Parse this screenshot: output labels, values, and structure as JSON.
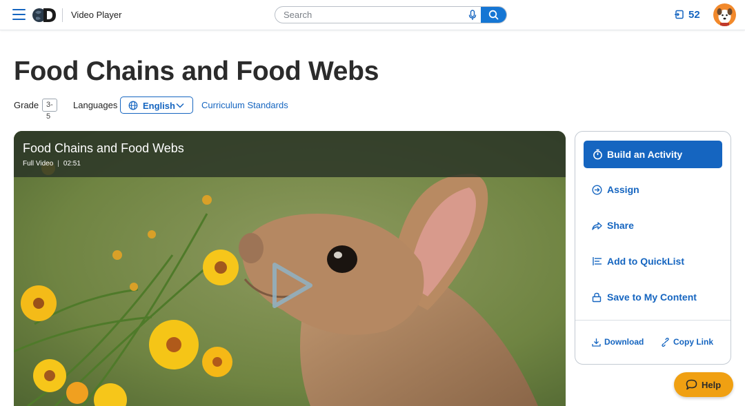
{
  "header": {
    "app_title": "Video Player",
    "search_placeholder": "Search",
    "notification_count": "52",
    "icons": [
      "menu-icon",
      "discovery-logo",
      "microphone-icon",
      "search-icon",
      "notification-icon",
      "avatar"
    ]
  },
  "page": {
    "title": "Food Chains and Food Webs",
    "grade_label": "Grade",
    "grade_value": "3-5",
    "languages_label": "Languages",
    "language_selected": "English",
    "curriculum_link": "Curriculum Standards"
  },
  "video": {
    "title": "Food Chains and Food Webs",
    "type": "Full Video",
    "duration": "02:51"
  },
  "actions": {
    "build_activity": "Build an Activity",
    "assign": "Assign",
    "share": "Share",
    "add_quicklist": "Add to QuickList",
    "save_content": "Save to My Content",
    "download": "Download",
    "copy_link": "Copy Link"
  },
  "help": {
    "label": "Help"
  },
  "colors": {
    "accent": "#1565c0",
    "help_button": "#f0a012",
    "avatar_bg": "#f2892b"
  }
}
